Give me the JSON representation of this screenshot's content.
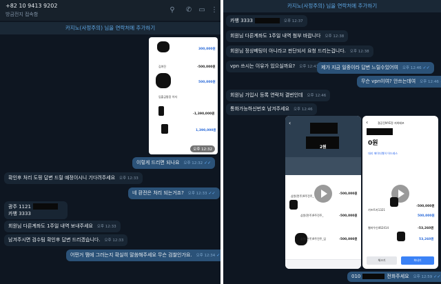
{
  "left_panel": {
    "header": {
      "title": "+82 10 9413 9202",
      "status": "방금전지 접속함"
    },
    "add_contact": "카지노(사정주의) 님을 연락처에 추가하기",
    "screenshot": {
      "rows": [
        {
          "label": "",
          "amount": "300,000원"
        },
        {
          "label": "김여진",
          "amount": "-500,000원"
        },
        {
          "label": "",
          "amount": "500,000원"
        },
        {
          "label": "입출금통장 이자",
          "amount": ""
        },
        {
          "label": "",
          "amount": "-1,390,000원"
        },
        {
          "label": "",
          "amount": "1,390,000원"
        }
      ],
      "time": "오후 12:32"
    },
    "messages": [
      {
        "dir": "out",
        "text": "이렇게 드리면 되나요",
        "time": "오후 12:32"
      },
      {
        "dir": "in",
        "text": "확인후 처리 도핑 답변 드릴 예정이시니 기다려주세요",
        "time": "오후 12:33"
      },
      {
        "dir": "out",
        "text": "네 환전은 처리 되는거죠?",
        "time": "오후 12:33"
      },
      {
        "dir": "in",
        "lines": [
          "광주 1121",
          "카뱅 3333"
        ],
        "time": ""
      },
      {
        "dir": "in",
        "text": "회원님 다른계좌도 1주일 내역 보내주세요",
        "time": "오후 12:33"
      },
      {
        "dir": "in",
        "text": "남겨주시면 검수팀 확인후 답변 드리겠습니다.",
        "time": "오후 12:33"
      },
      {
        "dir": "out",
        "text": "어떤거 땜에 그러는지 확실히 말씀해주세요 무슨 검찰인가요.",
        "time": "오후 12:34"
      }
    ]
  },
  "right_panel": {
    "add_contact": "카지노(사정주의) 님을 연락처에 추가하기",
    "messages": [
      {
        "dir": "in",
        "text": "카뱅 3333",
        "time": "오후 12:37"
      },
      {
        "dir": "in",
        "text": "회원님 다른계좌도 1주일 내역 첨부 바랍니다",
        "time": "오후 12:38"
      },
      {
        "dir": "in",
        "text": "회원님 정상베팅이 아니라고 판단되서 요청 드리는겁니다.",
        "time": "오후 12:38"
      },
      {
        "dir": "in",
        "text": "vpn 쓰시는 이유가 있으실까요?",
        "time": "오후 12:41"
      },
      {
        "dir": "out",
        "text": "제가 지금 일중이라 답변 느릴수있어여",
        "time": "오후 12:46"
      },
      {
        "dir": "out",
        "text": "무슨 vpn이여? 안쓰는데여",
        "time": "오후 12:46"
      },
      {
        "dir": "in",
        "text": "회원님 가입시 등록 연락처 결번인데",
        "time": "오후 12:46"
      },
      {
        "dir": "in",
        "text": "통화가능하신번호 남겨주세요",
        "time": "오후 12:46"
      },
      {
        "dir": "out",
        "text": "010",
        "suffix": "전화주세요",
        "time": "오후 12:59"
      }
    ],
    "phone_left": {
      "balance": "2원",
      "amounts": [
        "-500,000원",
        "-500,000원",
        "-500,000원"
      ],
      "labels": [
        "삼원(면주)9주전주_",
        "삼원(면주)9주전주_",
        "삼원(면주)9주전주_입"
      ]
    },
    "phone_right": {
      "title": "결공진NYE정 저희배포",
      "balance": "0원",
      "notice": "대리 에이더웨어 어드레스",
      "amounts": [
        "-500,000원",
        "500,000원",
        "-53,260원",
        "53,260원"
      ],
      "labels": [
        "기프트카1321",
        "",
        "웹마우신462414",
        ""
      ],
      "btn_left": "체크기",
      "btn_right": "화내기"
    }
  }
}
